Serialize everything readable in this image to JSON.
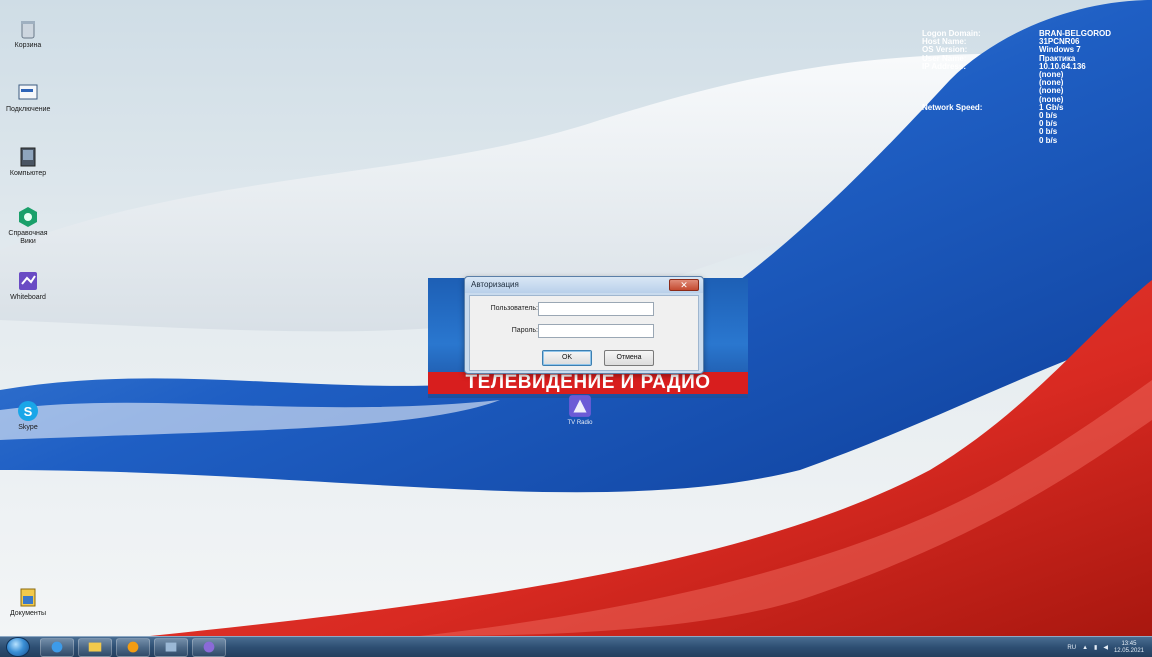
{
  "desktop": {
    "icons": [
      {
        "name": "recycle-bin",
        "label": "Корзина"
      },
      {
        "name": "app-2",
        "label": "Подключение"
      },
      {
        "name": "app-3",
        "label": "Компьютер"
      },
      {
        "name": "app-4",
        "label": "Справочная Вики"
      },
      {
        "name": "app-5",
        "label": "Whiteboard"
      },
      {
        "name": "skype",
        "label": "Skype"
      },
      {
        "name": "inbox",
        "label": "Документы"
      }
    ],
    "center_app_label": "TV Radio"
  },
  "sysinfo": [
    {
      "k": "Logon Domain:",
      "v": "BRAN-BELGOROD"
    },
    {
      "k": "Host Name:",
      "v": "31PCNR06"
    },
    {
      "k": "OS Version:",
      "v": "Windows 7"
    },
    {
      "k": "User Name:",
      "v": "Практика"
    },
    {
      "k": "IP Address:",
      "v": "10.10.64.136"
    },
    {
      "k": "",
      "v": "(none)"
    },
    {
      "k": "",
      "v": "(none)"
    },
    {
      "k": "",
      "v": "(none)"
    },
    {
      "k": "",
      "v": "(none)"
    },
    {
      "k": "Network Speed:",
      "v": "1 Gb/s"
    },
    {
      "k": "",
      "v": "0 b/s"
    },
    {
      "k": "",
      "v": "0 b/s"
    },
    {
      "k": "",
      "v": "0 b/s"
    },
    {
      "k": "",
      "v": "0 b/s"
    }
  ],
  "banner": {
    "text": "ТЕЛЕВИДЕНИЕ И РАДИО"
  },
  "login_dialog": {
    "title": "Авторизация",
    "close_glyph": "✕",
    "user_label": "Пользователь:",
    "user_value": "",
    "password_label": "Пароль:",
    "password_value": "",
    "ok_label": "OK",
    "cancel_label": "Отмена"
  },
  "taskbar": {
    "tray_lang": "RU",
    "clock_time": "13:45",
    "clock_date": "12.05.2021"
  },
  "colors": {
    "flag_blue": "#1f5fc4",
    "flag_red": "#d92a22",
    "banner_red": "#d81e1e"
  }
}
